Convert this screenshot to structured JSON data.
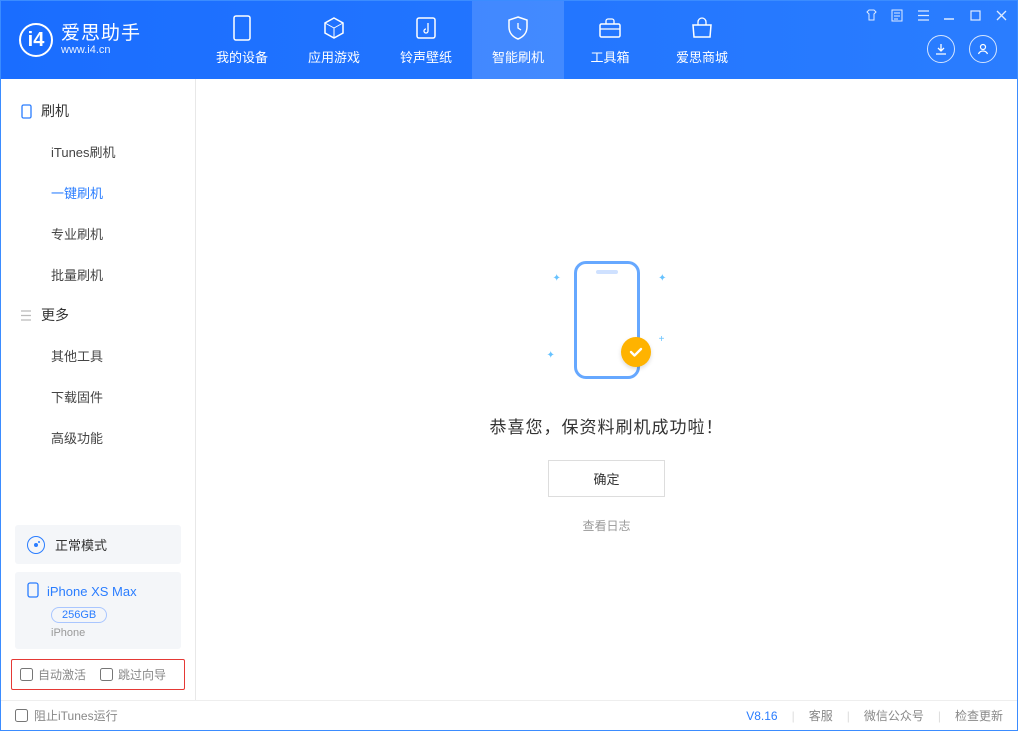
{
  "app": {
    "title": "爱思助手",
    "subtitle": "www.i4.cn"
  },
  "nav": {
    "tabs": [
      {
        "label": "我的设备",
        "icon": "device"
      },
      {
        "label": "应用游戏",
        "icon": "cube"
      },
      {
        "label": "铃声壁纸",
        "icon": "music"
      },
      {
        "label": "智能刷机",
        "icon": "shield",
        "active": true
      },
      {
        "label": "工具箱",
        "icon": "toolbox"
      },
      {
        "label": "爱思商城",
        "icon": "store"
      }
    ]
  },
  "sidebar": {
    "sections": [
      {
        "title": "刷机",
        "items": [
          {
            "label": "iTunes刷机"
          },
          {
            "label": "一键刷机",
            "active": true
          },
          {
            "label": "专业刷机"
          },
          {
            "label": "批量刷机"
          }
        ]
      },
      {
        "title": "更多",
        "items": [
          {
            "label": "其他工具"
          },
          {
            "label": "下载固件"
          },
          {
            "label": "高级功能"
          }
        ]
      }
    ],
    "mode": {
      "label": "正常模式"
    },
    "device": {
      "name": "iPhone XS Max",
      "storage": "256GB",
      "type": "iPhone"
    },
    "checkboxes": {
      "auto_activate": "自动激活",
      "skip_guide": "跳过向导"
    }
  },
  "main": {
    "message": "恭喜您，保资料刷机成功啦！",
    "ok_label": "确定",
    "log_link": "查看日志"
  },
  "footer": {
    "block_itunes": "阻止iTunes运行",
    "version": "V8.16",
    "links": [
      "客服",
      "微信公众号",
      "检查更新"
    ]
  }
}
